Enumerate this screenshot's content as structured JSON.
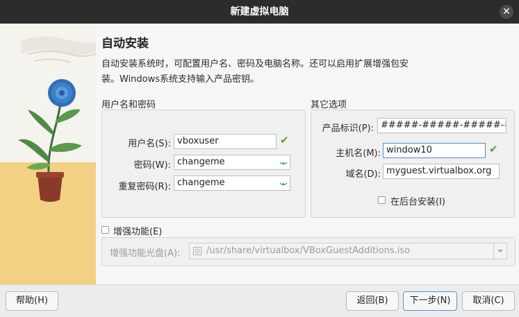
{
  "window": {
    "title": "新建虚拟电脑"
  },
  "page": {
    "heading": "自动安装",
    "description_line1": "自动安装系统时，可配置用户名、密码及电脑名称。还可以启用扩展增强包安",
    "description_line2": "装。Windows系统支持输入产品密钥。"
  },
  "user_group": {
    "title": "用户名和密码",
    "username_label": "用户名(S):",
    "username_value": "vboxuser",
    "password_label": "密码(W):",
    "password_value": "changeme",
    "repeat_label": "重复密码(R):",
    "repeat_value": "changeme"
  },
  "other_group": {
    "title": "其它选项",
    "product_key_label": "产品标识(P):",
    "product_key_value": "#####-#####-#####-###",
    "hostname_label": "主机名(M):",
    "hostname_value": "window10",
    "domain_label": "域名(D):",
    "domain_value": "myguest.virtualbox.org",
    "background_install_label": "在后台安装(I)",
    "background_install_checked": false
  },
  "additions": {
    "checkbox_label": "增强功能(E)",
    "checked": false,
    "iso_label": "增强功能光盘(A):",
    "iso_path": "/usr/share/virtualbox/VBoxGuestAdditions.iso"
  },
  "footer": {
    "help": "帮助(H)",
    "back": "返回(B)",
    "next": "下一步(N)",
    "cancel": "取消(C)"
  },
  "icons": {
    "close": "close-icon",
    "valid": "checkmark-icon",
    "password_eye": "eye-icon",
    "disc": "disc-icon",
    "dropdown": "chevron-down-icon"
  },
  "colors": {
    "titlebar": "#2c2c2c",
    "valid_check": "#5aa02c",
    "focus_border": "#4f8ec9"
  }
}
